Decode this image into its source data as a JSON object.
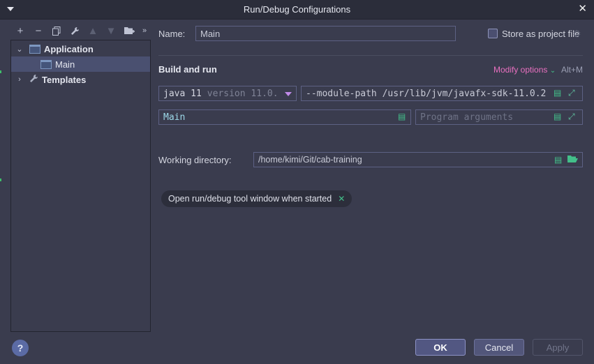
{
  "window": {
    "title": "Run/Debug Configurations"
  },
  "toolbar_icons": [
    "add-icon",
    "remove-icon",
    "copy-icon",
    "wrench-icon",
    "move-up-icon",
    "move-down-icon",
    "folder-icon",
    "more-icon"
  ],
  "tree": {
    "items": [
      {
        "label": "Application"
      },
      {
        "label": "Main"
      },
      {
        "label": "Templates"
      }
    ]
  },
  "name": {
    "label": "Name:",
    "value": "Main"
  },
  "store": {
    "label": "Store as project file"
  },
  "build": {
    "title": "Build and run",
    "modify_options": "Modify options",
    "shortcut": "Alt+M",
    "jdk": "java 11",
    "jdk_version": "version 11.0.",
    "vm_options": "--module-path /usr/lib/jvm/javafx-sdk-11.0.2",
    "main_class": "Main",
    "program_args_placeholder": "Program arguments"
  },
  "working_dir": {
    "label": "Working directory:",
    "value": "/home/kimi/Git/cab-training"
  },
  "chip": {
    "label": "Open run/debug tool window when started"
  },
  "buttons": {
    "help": "?",
    "ok": "OK",
    "cancel": "Cancel",
    "apply": "Apply"
  },
  "colors": {
    "accent_pink": "#e970c0",
    "accent_green": "#43c08a",
    "selection": "#4a5070"
  }
}
